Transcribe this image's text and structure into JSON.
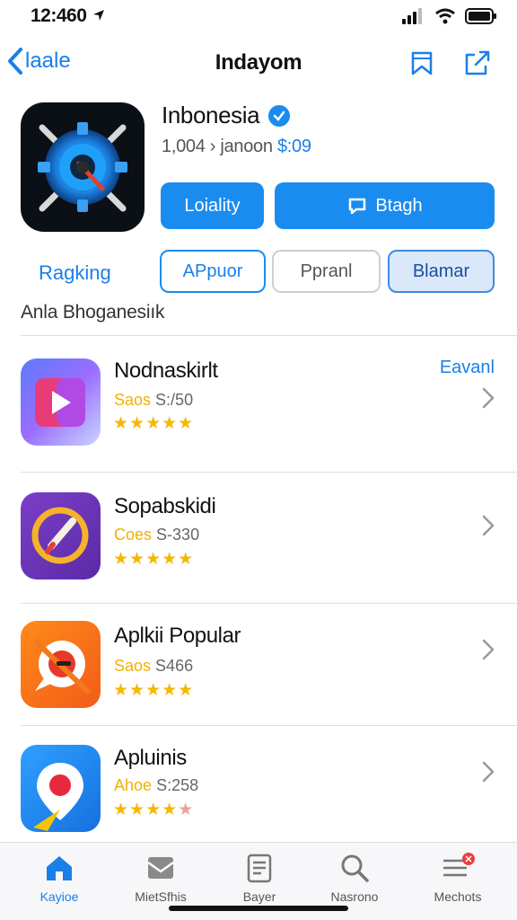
{
  "status": {
    "time": "12:460"
  },
  "nav": {
    "back_label": "laale",
    "title": "Indaуom"
  },
  "app": {
    "name": "Inbonesia",
    "subtitle_prefix": "1,004 › janoon",
    "price": "$:09",
    "primary_button": "Loiality",
    "secondary_button": "Btagh"
  },
  "filters": {
    "label": "Ragking",
    "pills": [
      "APpuor",
      "Ppranl",
      "Blamar"
    ],
    "active_pill": "Blamar"
  },
  "section_title": "Anla Bhoganesiık",
  "list": [
    {
      "title": "Nodnaskirlt",
      "tag": "Saos",
      "price": "S:/50",
      "rating": 5,
      "action": "Eavanl",
      "icon": "video-play-icon"
    },
    {
      "title": "Sopabskidi",
      "tag": "Coes",
      "price": "S-330",
      "rating": 5,
      "action": "",
      "icon": "compass-icon"
    },
    {
      "title": "Aplkii Popular",
      "tag": "Saos",
      "price": "S466",
      "rating": 5,
      "action": "",
      "icon": "chat-bubble-icon"
    },
    {
      "title": "Apluinis",
      "tag": "Ahoe",
      "price": "S:258",
      "rating": 4,
      "action": "",
      "icon": "map-pin-icon"
    }
  ],
  "tabs": [
    {
      "label": "Kayioe",
      "icon": "home-icon",
      "active": true
    },
    {
      "label": "MietSfhis",
      "icon": "inbox-icon",
      "active": false
    },
    {
      "label": "Bayer",
      "icon": "document-icon",
      "active": false
    },
    {
      "label": "Nasrono",
      "icon": "search-icon",
      "active": false
    },
    {
      "label": "Mechots",
      "icon": "menu-icon",
      "active": false
    }
  ],
  "colors": {
    "accent": "#1a8cf0",
    "star": "#f5b800",
    "price_tag": "#f2b000"
  }
}
